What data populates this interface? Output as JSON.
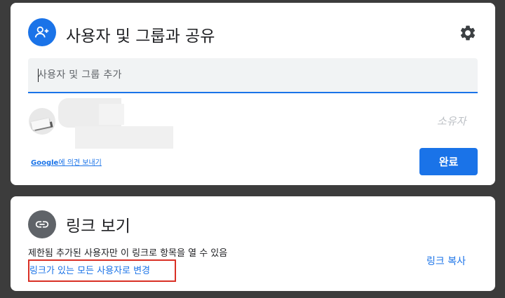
{
  "share_dialog": {
    "title": "사용자 및 그룹과 공유",
    "icon": "person-add-icon",
    "settings_icon": "gear-icon",
    "search": {
      "placeholder": "사용자 및 그룹 추가",
      "value": ""
    },
    "people": [
      {
        "name": "",
        "email": "",
        "role": "소유자"
      }
    ],
    "feedback": {
      "brand": "Google",
      "suffix": "에 의견 보내기"
    },
    "done_label": "완료"
  },
  "link_panel": {
    "title": "링크 보기",
    "icon": "link-icon",
    "restriction": "제한됨 추가된 사용자만 이 링크로 항목을 열 수 있음",
    "change_link": "링크가 있는 모든 사용자로 변경",
    "copy_link": "링크 복사"
  },
  "colors": {
    "accent": "#1a73e8",
    "highlight_border": "#d93025",
    "background": "#3c3c3c"
  }
}
